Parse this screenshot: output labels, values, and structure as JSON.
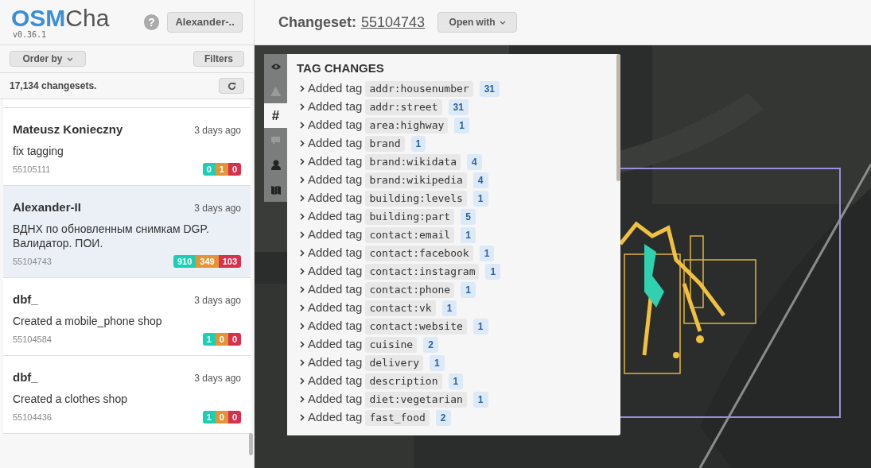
{
  "logo": {
    "bold": "OSM",
    "light": "Cha",
    "version": "v0.36.1"
  },
  "header": {
    "help": "?",
    "user": "Alexander-..",
    "title_label": "Changeset:",
    "changeset_id": "55104743",
    "open_with": "Open with"
  },
  "toolbar": {
    "order_by": "Order by",
    "filters": "Filters",
    "count": "17,134 changesets."
  },
  "changesets": [
    {
      "user": "Mateusz Konieczny",
      "time": "3 days ago",
      "comment": "fix tagging",
      "id": "55105111",
      "create": "0",
      "modify": "1",
      "delete": "0",
      "selected": false
    },
    {
      "user": "Alexander-II",
      "time": "3 days ago",
      "comment": "ВДНХ по обновленным снимкам DGP. Валидатор. ПОИ.",
      "id": "55104743",
      "create": "910",
      "modify": "349",
      "delete": "103",
      "selected": true
    },
    {
      "user": "dbf_",
      "time": "3 days ago",
      "comment": "Created a mobile_phone shop",
      "id": "55104584",
      "create": "1",
      "modify": "0",
      "delete": "0",
      "selected": false
    },
    {
      "user": "dbf_",
      "time": "3 days ago",
      "comment": "Created a clothes shop",
      "id": "55104436",
      "create": "1",
      "modify": "0",
      "delete": "0",
      "selected": false
    }
  ],
  "panel_tabs": [
    {
      "kind": "eye",
      "selected": false
    },
    {
      "kind": "warning",
      "selected": false
    },
    {
      "kind": "hash",
      "label": "#",
      "selected": true
    },
    {
      "kind": "comment",
      "selected": false
    },
    {
      "kind": "user",
      "selected": false
    },
    {
      "kind": "map",
      "selected": false
    }
  ],
  "tag_changes": {
    "title": "TAG CHANGES",
    "rows": [
      {
        "action": "Added tag",
        "tag": "addr:housenumber",
        "count": "31"
      },
      {
        "action": "Added tag",
        "tag": "addr:street",
        "count": "31"
      },
      {
        "action": "Added tag",
        "tag": "area:highway",
        "count": "1"
      },
      {
        "action": "Added tag",
        "tag": "brand",
        "count": "1"
      },
      {
        "action": "Added tag",
        "tag": "brand:wikidata",
        "count": "4"
      },
      {
        "action": "Added tag",
        "tag": "brand:wikipedia",
        "count": "4"
      },
      {
        "action": "Added tag",
        "tag": "building:levels",
        "count": "1"
      },
      {
        "action": "Added tag",
        "tag": "building:part",
        "count": "5"
      },
      {
        "action": "Added tag",
        "tag": "contact:email",
        "count": "1"
      },
      {
        "action": "Added tag",
        "tag": "contact:facebook",
        "count": "1"
      },
      {
        "action": "Added tag",
        "tag": "contact:instagram",
        "count": "1"
      },
      {
        "action": "Added tag",
        "tag": "contact:phone",
        "count": "1"
      },
      {
        "action": "Added tag",
        "tag": "contact:vk",
        "count": "1"
      },
      {
        "action": "Added tag",
        "tag": "contact:website",
        "count": "1"
      },
      {
        "action": "Added tag",
        "tag": "cuisine",
        "count": "2"
      },
      {
        "action": "Added tag",
        "tag": "delivery",
        "count": "1"
      },
      {
        "action": "Added tag",
        "tag": "description",
        "count": "1"
      },
      {
        "action": "Added tag",
        "tag": "diet:vegetarian",
        "count": "1"
      },
      {
        "action": "Added tag",
        "tag": "fast_food",
        "count": "2"
      }
    ]
  }
}
